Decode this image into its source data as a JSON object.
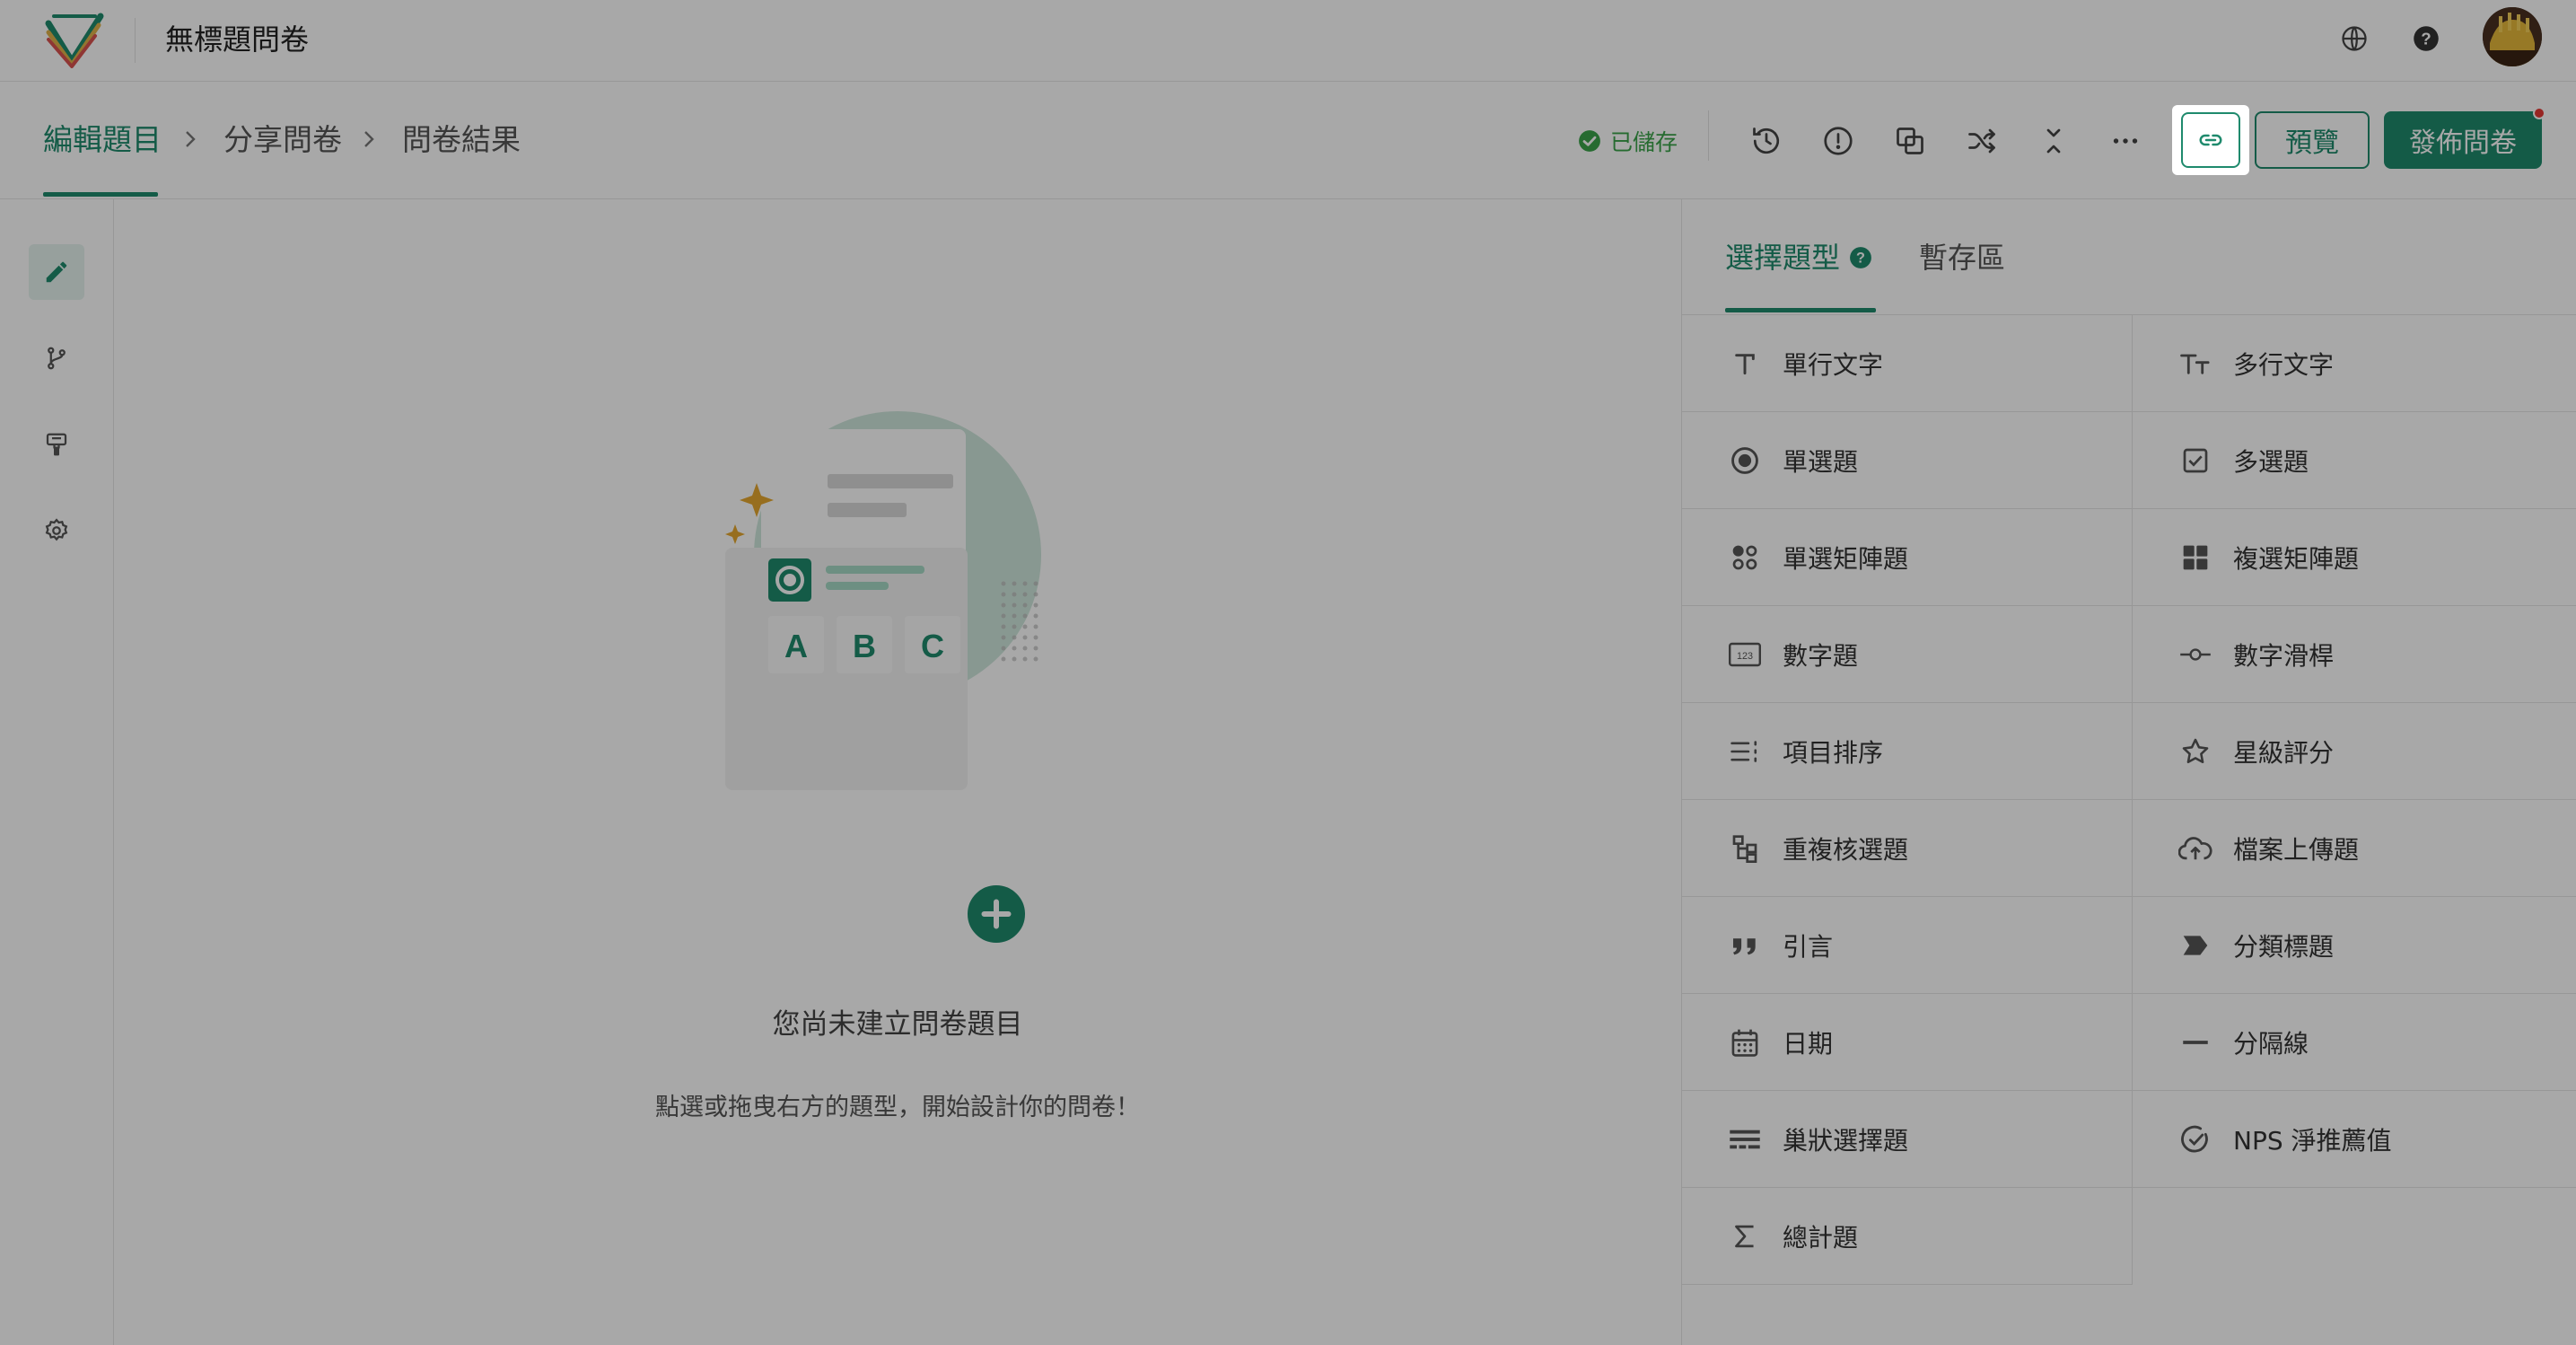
{
  "app": {
    "title": "無標題問卷"
  },
  "breadcrumb": {
    "items": [
      "編輯題目",
      "分享問卷",
      "問卷結果"
    ]
  },
  "toolbar": {
    "saved_label": "已儲存",
    "preview_label": "預覽",
    "publish_label": "發佈問卷"
  },
  "panel": {
    "tabs": [
      "選擇題型",
      "暫存區"
    ],
    "question_types": [
      {
        "label": "單行文字",
        "icon": "text-icon"
      },
      {
        "label": "多行文字",
        "icon": "multiline-text-icon"
      },
      {
        "label": "單選題",
        "icon": "radio-icon"
      },
      {
        "label": "多選題",
        "icon": "checkbox-icon"
      },
      {
        "label": "單選矩陣題",
        "icon": "radio-matrix-icon"
      },
      {
        "label": "複選矩陣題",
        "icon": "checkbox-matrix-icon"
      },
      {
        "label": "數字題",
        "icon": "number-icon"
      },
      {
        "label": "數字滑桿",
        "icon": "slider-icon"
      },
      {
        "label": "項目排序",
        "icon": "ranking-icon"
      },
      {
        "label": "星級評分",
        "icon": "star-icon"
      },
      {
        "label": "重複核選題",
        "icon": "hierarchy-icon"
      },
      {
        "label": "檔案上傳題",
        "icon": "cloud-upload-icon"
      },
      {
        "label": "引言",
        "icon": "quote-icon"
      },
      {
        "label": "分類標題",
        "icon": "section-tag-icon"
      },
      {
        "label": "日期",
        "icon": "calendar-icon"
      },
      {
        "label": "分隔線",
        "icon": "divider-line-icon"
      },
      {
        "label": "巢狀選擇題",
        "icon": "nested-select-icon"
      },
      {
        "label": "NPS 淨推薦值",
        "icon": "nps-gauge-icon"
      },
      {
        "label": "總計題",
        "icon": "sigma-icon"
      }
    ]
  },
  "empty_state": {
    "title": "您尚未建立問卷題目",
    "description": "點選或拖曳右方的題型，開始設計你的問卷！",
    "illustration_letters": [
      "A",
      "B",
      "C"
    ]
  },
  "colors": {
    "accent": "#1f8a6d",
    "saved": "#3ba34a",
    "notification": "#e53935",
    "overlay": "rgba(0,0,0,0.34)"
  }
}
